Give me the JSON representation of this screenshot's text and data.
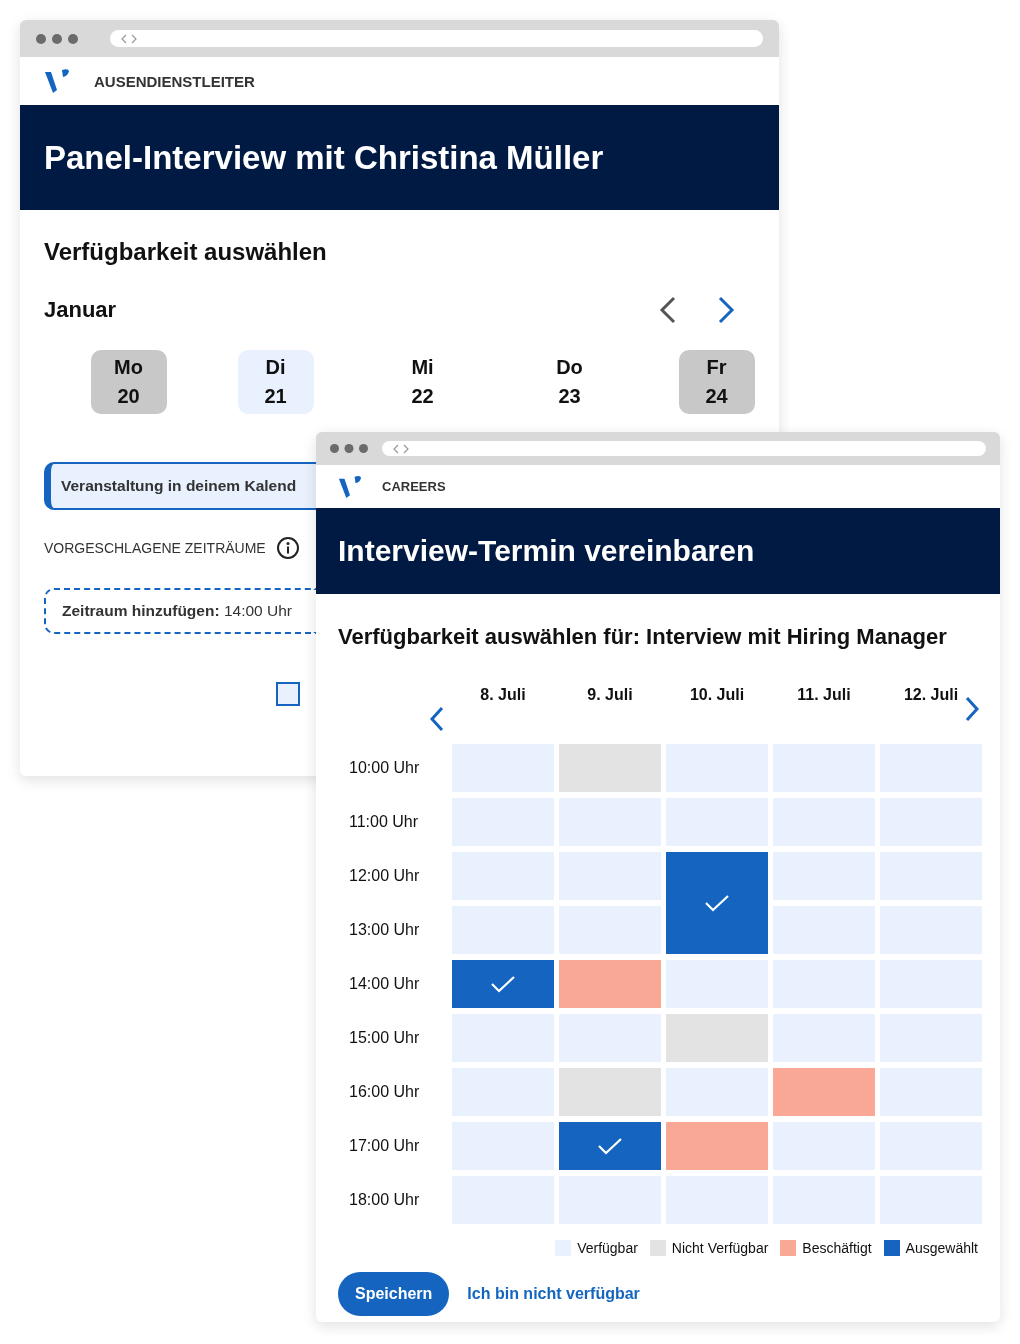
{
  "back_window": {
    "brand": "AUSENDIENSTLEITER",
    "title": "Panel-Interview mit Christina Müller",
    "heading": "Verfügbarkeit auswählen",
    "month": "Januar",
    "prev_disabled": true,
    "days": [
      {
        "weekday": "Mo",
        "date": "20",
        "kind": "unavailable"
      },
      {
        "weekday": "Di",
        "date": "21",
        "kind": "available"
      },
      {
        "weekday": "Mi",
        "date": "22",
        "kind": "plain"
      },
      {
        "weekday": "Do",
        "date": "23",
        "kind": "plain"
      },
      {
        "weekday": "Fr",
        "date": "24",
        "kind": "unavailable"
      }
    ],
    "calendar_event": "Veranstaltung in deinem Kalend",
    "suggested_label": "VORGESCHLAGENE ZEITRÄUME",
    "add_slot": "**Zeitraum hinzufügen:** 14:00 Uhr",
    "checkbox": {
      "checked": false
    }
  },
  "front_window": {
    "brand": "CAREERS",
    "title": "Interview-Termin vereinbaren",
    "heading": "Verfügbarkeit auswählen für: Interview mit Hiring Manager",
    "days": [
      "8. Juli",
      "9. Juli",
      "10. Juli",
      "11. Juli",
      "12. Juli"
    ],
    "rows": [
      {
        "time": "10:00 Uhr",
        "cells": [
          {
            "kind": "available"
          },
          {
            "kind": "unavailable"
          },
          {
            "kind": "available"
          },
          {
            "kind": "available"
          },
          {
            "kind": "available"
          }
        ]
      },
      {
        "time": "11:00 Uhr",
        "cells": [
          {
            "kind": "available"
          },
          {
            "kind": "available"
          },
          {
            "kind": "available"
          },
          {
            "kind": "available"
          },
          {
            "kind": "available"
          }
        ]
      },
      {
        "time": "12:00 Uhr",
        "cells": [
          {
            "kind": "available"
          },
          {
            "kind": "available"
          },
          {
            "kind": "selected"
          },
          {
            "kind": "available"
          },
          {
            "kind": "available"
          }
        ]
      },
      {
        "time": "13:00 Uhr",
        "cells": [
          {
            "kind": "available"
          },
          {
            "kind": "available"
          },
          {
            "kind": "selected"
          },
          {
            "kind": "available"
          },
          {
            "kind": "available"
          }
        ]
      },
      {
        "time": "14:00 Uhr",
        "cells": [
          {
            "kind": "selected"
          },
          {
            "kind": "busy"
          },
          {
            "kind": "available"
          },
          {
            "kind": "available"
          },
          {
            "kind": "available"
          }
        ]
      },
      {
        "time": "15:00 Uhr",
        "cells": [
          {
            "kind": "available"
          },
          {
            "kind": "available"
          },
          {
            "kind": "unavailable"
          },
          {
            "kind": "available"
          },
          {
            "kind": "available"
          }
        ]
      },
      {
        "time": "16:00 Uhr",
        "cells": [
          {
            "kind": "available"
          },
          {
            "kind": "unavailable"
          },
          {
            "kind": "available"
          },
          {
            "kind": "busy"
          },
          {
            "kind": "available"
          }
        ]
      },
      {
        "time": "17:00 Uhr",
        "cells": [
          {
            "kind": "available"
          },
          {
            "kind": "selected"
          },
          {
            "kind": "busy"
          },
          {
            "kind": "available"
          },
          {
            "kind": "available"
          }
        ]
      },
      {
        "time": "18:00 Uhr",
        "cells": [
          {
            "kind": "available"
          },
          {
            "kind": "available"
          },
          {
            "kind": "available"
          },
          {
            "kind": "available"
          },
          {
            "kind": "available"
          }
        ]
      }
    ],
    "legend": [
      {
        "kind": "available",
        "label": "Verfügbar",
        "color": "#e8f1fd"
      },
      {
        "kind": "unavailable",
        "label": "Nicht Verfügbar",
        "color": "#e3e3e3"
      },
      {
        "kind": "busy",
        "label": "Beschäftigt",
        "color": "#f9a895"
      },
      {
        "kind": "selected",
        "label": "Ausgewählt",
        "color": "#1565c0"
      }
    ],
    "save_button": "Speichern",
    "decline_link": "Ich bin nicht verfügbar"
  }
}
